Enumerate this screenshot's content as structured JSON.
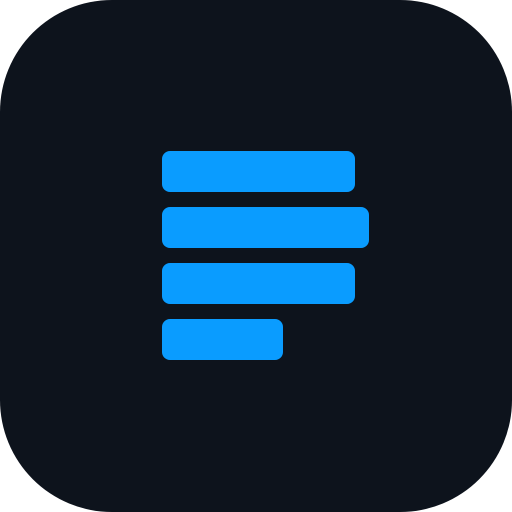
{
  "icon": {
    "name": "text-lines-app-icon",
    "background_color": "#0d131c",
    "accent_color": "#0a9cff"
  }
}
